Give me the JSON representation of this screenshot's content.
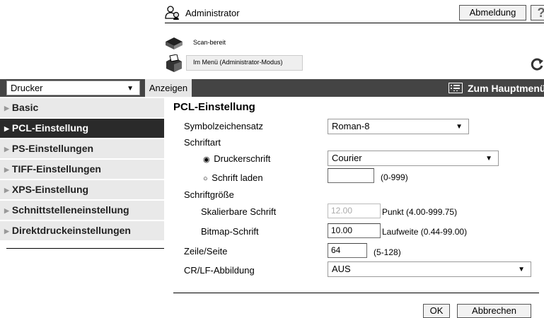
{
  "header": {
    "user_label": "Administrator",
    "logout_label": "Abmeldung",
    "help_label": "?"
  },
  "status": {
    "scanner_status": "Scan-bereit",
    "mode_status": "Im Menü (Administrator-Modus)",
    "refresh_icon": "refresh-icon"
  },
  "toolbar": {
    "category_select": "Drucker",
    "view_button": "Anzeigen",
    "main_menu_link": "Zum Hauptmenü"
  },
  "sidebar": {
    "items": [
      {
        "label": "Basic",
        "active": false
      },
      {
        "label": "PCL-Einstellung",
        "active": true
      },
      {
        "label": "PS-Einstellungen",
        "active": false
      },
      {
        "label": "TIFF-Einstellungen",
        "active": false
      },
      {
        "label": "XPS-Einstellung",
        "active": false
      },
      {
        "label": "Schnittstelleneinstellung",
        "active": false
      },
      {
        "label": "Direktdruckeinstellungen",
        "active": false
      }
    ]
  },
  "main": {
    "title": "PCL-Einstellung",
    "symbol_set_label": "Symbolzeichensatz",
    "symbol_set_value": "Roman-8",
    "font_label": "Schriftart",
    "printer_font_label": "Druckerschrift",
    "printer_font_value": "Courier",
    "download_font_label": "Schrift laden",
    "download_font_value": "",
    "download_font_range": "(0-999)",
    "font_size_label": "Schriftgröße",
    "scalable_font_label": "Skalierbare Schrift",
    "scalable_font_value": "12.00",
    "scalable_font_unit": "Punkt (4.00-999.75)",
    "bitmap_font_label": "Bitmap-Schrift",
    "bitmap_font_value": "10.00",
    "bitmap_font_unit": "Laufweite (0.44-99.00)",
    "lines_per_page_label": "Zeile/Seite",
    "lines_per_page_value": "64",
    "lines_per_page_range": "(5-128)",
    "crlf_label": "CR/LF-Abbildung",
    "crlf_value": "AUS",
    "ok_label": "OK",
    "cancel_label": "Abbrechen"
  },
  "colors": {
    "active_menu_bg": "#2a2a2a",
    "menu_bg": "#e9e9e9",
    "toolbar_bg": "#444444"
  }
}
